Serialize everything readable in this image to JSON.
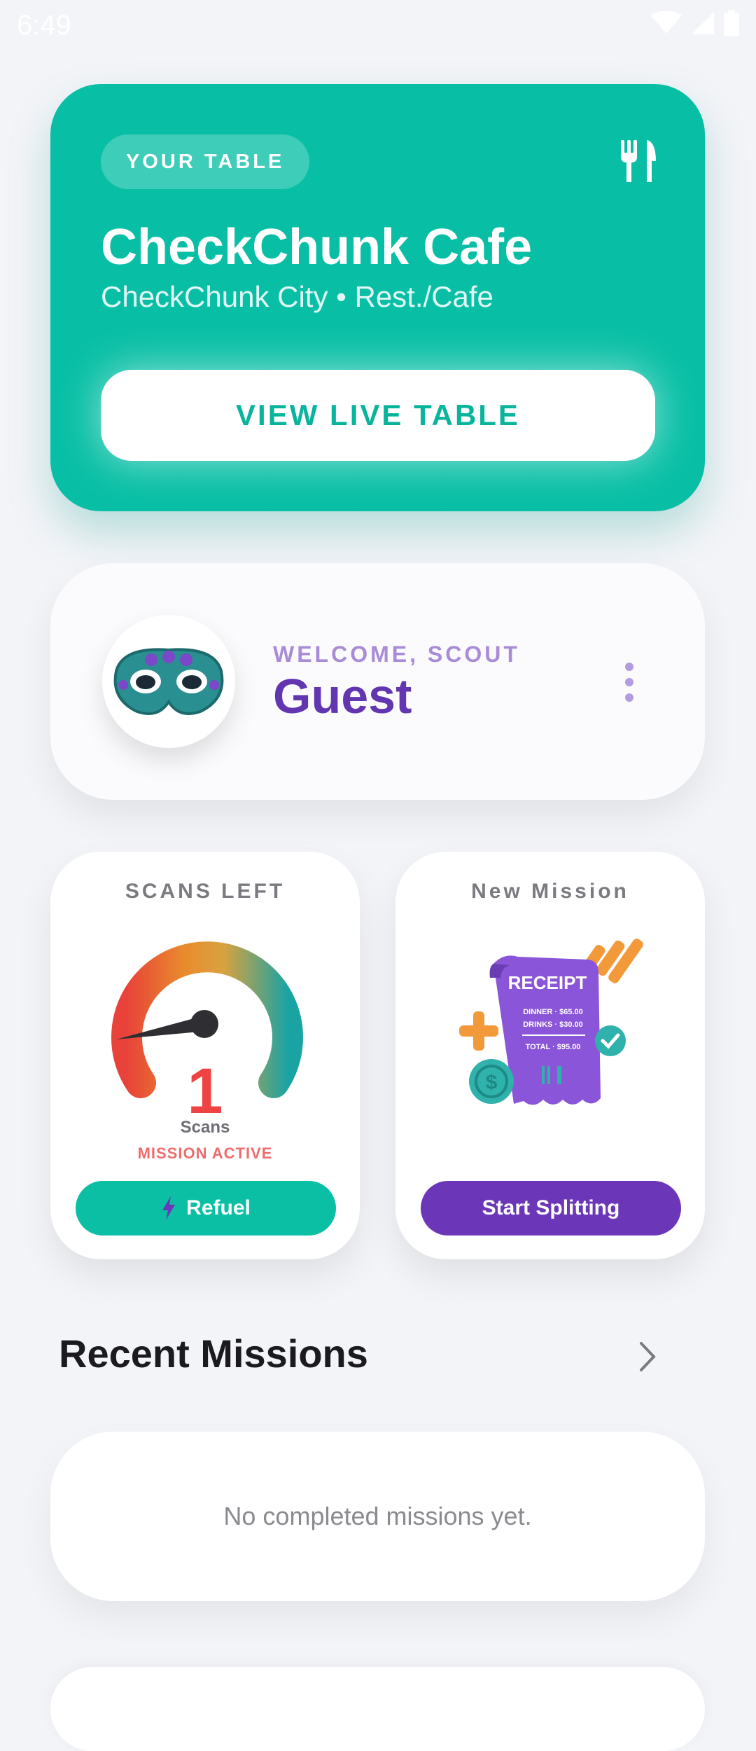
{
  "status_bar": {
    "time": "6:49"
  },
  "table_card": {
    "pill_label": "YOUR TABLE",
    "name": "CheckChunk Cafe",
    "subtitle": "CheckChunk City • Rest./Cafe",
    "button_label": "VIEW LIVE TABLE",
    "icon": "utensils-icon"
  },
  "welcome_card": {
    "label": "WELCOME, SCOUT",
    "name": "Guest",
    "avatar_icon": "mask-icon"
  },
  "scans_card": {
    "title": "SCANS LEFT",
    "count": "1",
    "unit": "Scans",
    "status": "MISSION ACTIVE",
    "button_label": "Refuel",
    "button_icon": "lightning-icon"
  },
  "mission_card": {
    "title": "New Mission",
    "button_label": "Start Splitting",
    "art": {
      "header": "RECEIPT",
      "line1": "DINNER · $65.00",
      "line2": "DRINKS · $30.00",
      "line3": "TOTAL · $95.00"
    }
  },
  "recent_missions": {
    "title": "Recent Missions",
    "empty_text": "No completed missions yet."
  },
  "colors": {
    "teal": "#08bfa5",
    "purple": "#6b37b8",
    "red": "#ef4343"
  }
}
